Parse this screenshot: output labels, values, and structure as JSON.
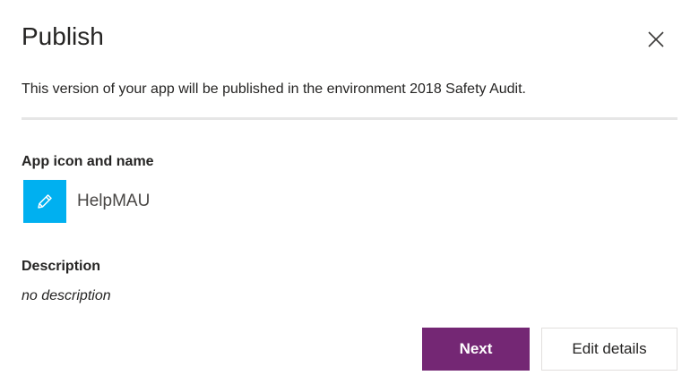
{
  "dialog": {
    "title": "Publish",
    "subtitle": "This version of your app will be published in the environment 2018 Safety Audit."
  },
  "app_section": {
    "label": "App icon and name",
    "app_name": "HelpMAU",
    "icon": "pencil-icon",
    "icon_color": "#00b0f0"
  },
  "description_section": {
    "label": "Description",
    "value": "no description"
  },
  "buttons": {
    "next_label": "Next",
    "edit_label": "Edit details",
    "primary_color": "#742774"
  },
  "icons": {
    "close": "close-icon"
  }
}
